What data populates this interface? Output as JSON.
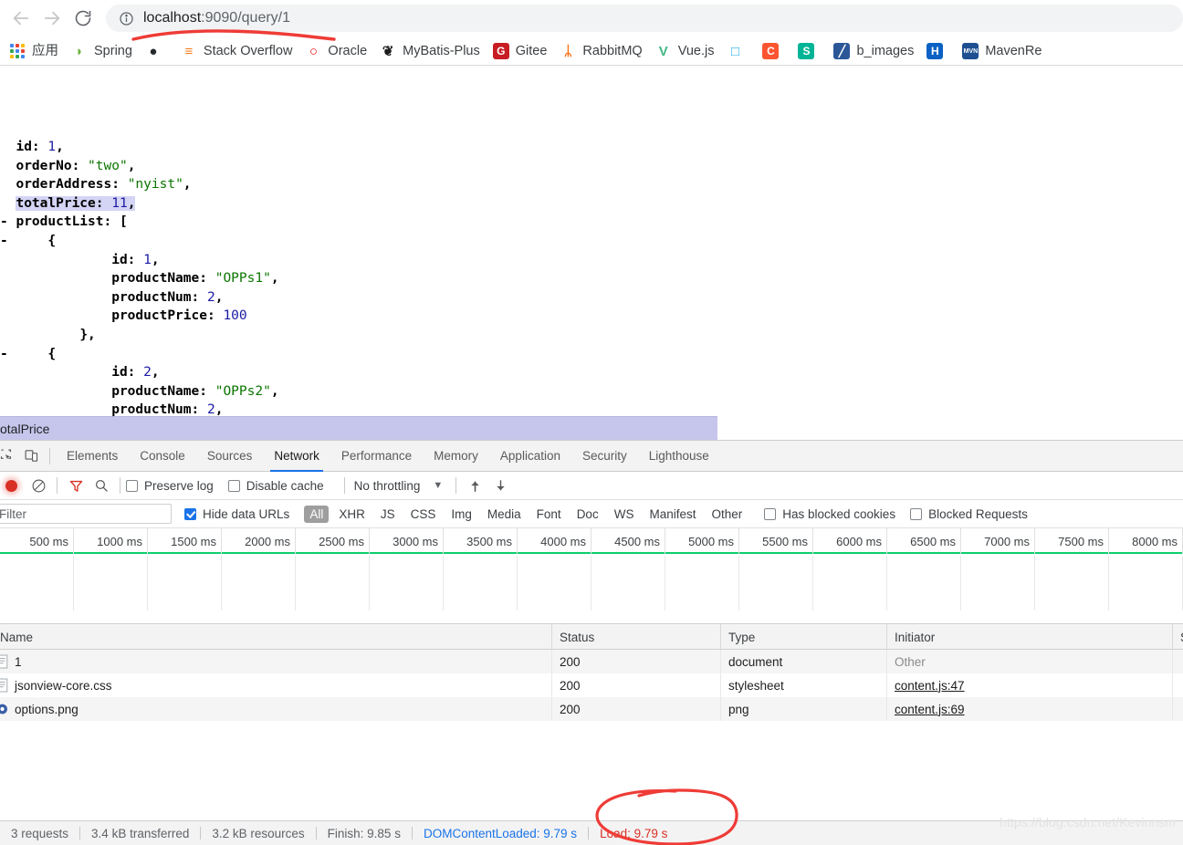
{
  "browser": {
    "nav": {
      "back_icon": "arrow-left-icon",
      "forward_icon": "arrow-right-icon",
      "reload_icon": "reload-icon"
    },
    "omnibox": {
      "info_icon": "info-circle-icon",
      "url_host": "localhost",
      "url_rest": ":9090/query/1",
      "url_full": "localhost:9090/query/1"
    },
    "bookmarks": {
      "apps_label": "应用",
      "items": [
        {
          "label": "Spring",
          "icon": "spring-leaf-icon",
          "color": "#6db33f",
          "glyph": "◗"
        },
        {
          "label": "",
          "icon": "github-icon",
          "color": "#24292e",
          "glyph": "●"
        },
        {
          "label": "Stack Overflow",
          "icon": "stackoverflow-icon",
          "color": "#f48024",
          "glyph": "≡"
        },
        {
          "label": "Oracle",
          "icon": "oracle-icon",
          "color": "#f80000",
          "glyph": "○"
        },
        {
          "label": "MyBatis-Plus",
          "icon": "mybatis-bird-icon",
          "color": "#1b1b1b",
          "glyph": "❦"
        },
        {
          "label": "Gitee",
          "icon": "gitee-icon",
          "color": "#c71d23",
          "glyph": "G"
        },
        {
          "label": "RabbitMQ",
          "icon": "rabbitmq-icon",
          "color": "#ff6600",
          "glyph": "ᛦ"
        },
        {
          "label": "Vue.js",
          "icon": "vuejs-icon",
          "color": "#42b883",
          "glyph": "V"
        },
        {
          "label": "",
          "icon": "bilibili-icon",
          "color": "#23ade5",
          "glyph": "□"
        },
        {
          "label": "",
          "icon": "csdn-icon",
          "color": "#fc5531",
          "glyph": "C"
        },
        {
          "label": "",
          "icon": "segmentfault-icon",
          "color": "#00b496",
          "glyph": "S"
        },
        {
          "label": "b_images",
          "icon": "blue-note-icon",
          "color": "#2b5797",
          "glyph": "╱"
        },
        {
          "label": "",
          "icon": "h-site-icon",
          "color": "#0b62c4",
          "glyph": "H"
        },
        {
          "label": "MavenRe",
          "icon": "maven-icon",
          "color": "#1d4f91",
          "glyph": "MVN"
        }
      ]
    }
  },
  "page": {
    "json_lines": [
      {
        "indent": 0,
        "collapse": "",
        "parts": [
          {
            "t": "id: ",
            "c": "k"
          },
          {
            "t": "1",
            "c": "n"
          },
          {
            "t": ",",
            "c": "k"
          }
        ]
      },
      {
        "indent": 0,
        "collapse": "",
        "parts": [
          {
            "t": "orderNo: ",
            "c": "k"
          },
          {
            "t": "\"two\"",
            "c": "s"
          },
          {
            "t": ",",
            "c": "k"
          }
        ]
      },
      {
        "indent": 0,
        "collapse": "",
        "parts": [
          {
            "t": "orderAddress: ",
            "c": "k"
          },
          {
            "t": "\"nyist\"",
            "c": "s"
          },
          {
            "t": ",",
            "c": "k"
          }
        ]
      },
      {
        "indent": 0,
        "collapse": "",
        "hl": true,
        "parts": [
          {
            "t": "totalPrice: ",
            "c": "k"
          },
          {
            "t": "11",
            "c": "n"
          },
          {
            "t": ",",
            "c": "k"
          }
        ]
      },
      {
        "indent": 0,
        "collapse": "-",
        "parts": [
          {
            "t": "productList: [",
            "c": "k"
          }
        ]
      },
      {
        "indent": 1,
        "collapse": "-",
        "parts": [
          {
            "t": "{",
            "c": "k"
          }
        ]
      },
      {
        "indent": 3,
        "collapse": "",
        "parts": [
          {
            "t": "id: ",
            "c": "k"
          },
          {
            "t": "1",
            "c": "n"
          },
          {
            "t": ",",
            "c": "k"
          }
        ]
      },
      {
        "indent": 3,
        "collapse": "",
        "parts": [
          {
            "t": "productName: ",
            "c": "k"
          },
          {
            "t": "\"OPPs1\"",
            "c": "s"
          },
          {
            "t": ",",
            "c": "k"
          }
        ]
      },
      {
        "indent": 3,
        "collapse": "",
        "parts": [
          {
            "t": "productNum: ",
            "c": "k"
          },
          {
            "t": "2",
            "c": "n"
          },
          {
            "t": ",",
            "c": "k"
          }
        ]
      },
      {
        "indent": 3,
        "collapse": "",
        "parts": [
          {
            "t": "productPrice: ",
            "c": "k"
          },
          {
            "t": "100",
            "c": "n"
          }
        ]
      },
      {
        "indent": 2,
        "collapse": "",
        "parts": [
          {
            "t": "},",
            "c": "k"
          }
        ]
      },
      {
        "indent": 1,
        "collapse": "-",
        "parts": [
          {
            "t": "{",
            "c": "k"
          }
        ]
      },
      {
        "indent": 3,
        "collapse": "",
        "parts": [
          {
            "t": "id: ",
            "c": "k"
          },
          {
            "t": "2",
            "c": "n"
          },
          {
            "t": ",",
            "c": "k"
          }
        ]
      },
      {
        "indent": 3,
        "collapse": "",
        "parts": [
          {
            "t": "productName: ",
            "c": "k"
          },
          {
            "t": "\"OPPs2\"",
            "c": "s"
          },
          {
            "t": ",",
            "c": "k"
          }
        ]
      },
      {
        "indent": 3,
        "collapse": "",
        "parts": [
          {
            "t": "productNum: ",
            "c": "k"
          },
          {
            "t": "2",
            "c": "n"
          },
          {
            "t": ",",
            "c": "k"
          }
        ]
      }
    ]
  },
  "overlay": {
    "text": "otalPrice",
    "full_text": "totalPrice",
    "background": "#c6c6ec"
  },
  "devtools": {
    "toolbar_icons": {
      "inspect": "inspect-element-icon",
      "device": "device-toolbar-icon"
    },
    "tabs": [
      {
        "label": "Elements",
        "active": false
      },
      {
        "label": "Console",
        "active": false
      },
      {
        "label": "Sources",
        "active": false
      },
      {
        "label": "Network",
        "active": true
      },
      {
        "label": "Performance",
        "active": false
      },
      {
        "label": "Memory",
        "active": false
      },
      {
        "label": "Application",
        "active": false
      },
      {
        "label": "Security",
        "active": false
      },
      {
        "label": "Lighthouse",
        "active": false
      }
    ],
    "network_toolbar": {
      "record_icon": "record-stop-icon",
      "clear_icon": "clear-network-icon",
      "filter_icon": "filter-funnel-icon",
      "search_icon": "search-icon",
      "preserve_log_label": "Preserve log",
      "preserve_log_checked": false,
      "disable_cache_label": "Disable cache",
      "disable_cache_checked": false,
      "throttling_value": "No throttling",
      "throttling_caret": "chevron-down-icon",
      "import_icon": "import-har-icon",
      "export_icon": "export-har-icon"
    },
    "filter_bar": {
      "filter_placeholder": "Filter",
      "filter_value": "",
      "hide_data_urls_label": "Hide data URLs",
      "hide_data_urls_checked": true,
      "types": [
        "All",
        "XHR",
        "JS",
        "CSS",
        "Img",
        "Media",
        "Font",
        "Doc",
        "WS",
        "Manifest",
        "Other"
      ],
      "selected_type": "All",
      "has_blocked_cookies_label": "Has blocked cookies",
      "has_blocked_cookies_checked": false,
      "blocked_requests_label": "Blocked Requests",
      "blocked_requests_checked": false
    },
    "overview": {
      "ticks": [
        "500 ms",
        "1000 ms",
        "1500 ms",
        "2000 ms",
        "2500 ms",
        "3000 ms",
        "3500 ms",
        "4000 ms",
        "4500 ms",
        "5000 ms",
        "5500 ms",
        "6000 ms",
        "6500 ms",
        "7000 ms",
        "7500 ms",
        "8000 ms"
      ],
      "load_line_color": "#0cce6b"
    },
    "table": {
      "columns": [
        "Name",
        "Status",
        "Type",
        "Initiator",
        "S"
      ],
      "rows": [
        {
          "name": "1",
          "status": "200",
          "type": "document",
          "initiator": "Other",
          "initiator_link": false,
          "icon": "document-file-icon"
        },
        {
          "name": "jsonview-core.css",
          "status": "200",
          "type": "stylesheet",
          "initiator": "content.js:47",
          "initiator_link": true,
          "icon": "stylesheet-file-icon"
        },
        {
          "name": "options.png",
          "status": "200",
          "type": "png",
          "initiator": "content.js:69",
          "initiator_link": true,
          "icon": "image-file-icon"
        }
      ]
    },
    "status_bar": {
      "requests": "3 requests",
      "transferred": "3.4 kB transferred",
      "resources": "3.2 kB resources",
      "finish": "Finish: 9.85 s",
      "dom_content_loaded": "DOMContentLoaded: 9.79 s",
      "load": "Load: 9.79 s",
      "dom_color": "#1a73e8",
      "load_color": "#d93025"
    }
  },
  "watermark": {
    "text": "https://blog.csdn.net/Kevinnsm"
  },
  "annotations": {
    "stroke_color": "#ef3b36",
    "underline_bookmarkbar": "red-stroke-under-omnibox",
    "circle_load": "red-ellipse-around-load-metric"
  }
}
